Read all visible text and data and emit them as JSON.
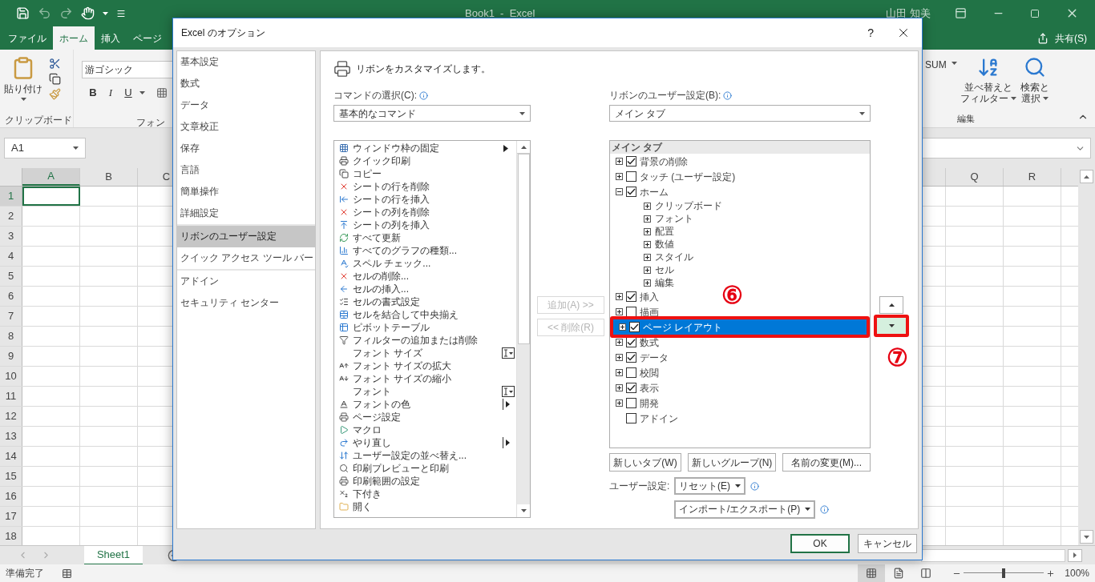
{
  "window": {
    "title": "Book1  -  Excel",
    "user": "山田 知美"
  },
  "ribbon_tabs": [
    {
      "label": "ファイル",
      "selected": false
    },
    {
      "label": "ホーム",
      "selected": true
    },
    {
      "label": "挿入",
      "selected": false
    },
    {
      "label": "ページ",
      "selected": false
    }
  ],
  "share": "共有(S)",
  "ribbon": {
    "paste": "貼り付け",
    "clipboard_group": "クリップボード",
    "font_name": "游ゴシック",
    "format_buttons": [
      "B",
      "I",
      "U"
    ],
    "font_group": "フォン",
    "autosum": "SUM",
    "sort": [
      "並べ替えと",
      "フィルター"
    ],
    "find": [
      "検索と",
      "選択"
    ],
    "editing_group": "編集"
  },
  "name_box": "A1",
  "columns": [
    "A",
    "B",
    "C",
    "Q",
    "R"
  ],
  "rows": [
    "1",
    "2",
    "3",
    "4",
    "5",
    "6",
    "7",
    "8",
    "9",
    "10",
    "11",
    "12",
    "13",
    "14",
    "15",
    "16",
    "17",
    "18"
  ],
  "sheet_tabs": [
    {
      "label": "Sheet1",
      "selected": true
    }
  ],
  "status_bar": {
    "text": "準備完了",
    "views": [
      {
        "selected": true
      },
      {
        "selected": false
      },
      {
        "selected": false
      }
    ],
    "zoom_slider": {
      "level": 0.5
    },
    "zoom": "100%"
  },
  "dialog": {
    "title": "Excel のオプション",
    "help": "?",
    "nav_sections": [
      [
        {
          "label": "基本設定",
          "selected": false
        },
        {
          "label": "数式",
          "selected": false
        },
        {
          "label": "データ",
          "selected": false
        },
        {
          "label": "文章校正",
          "selected": false
        },
        {
          "label": "保存",
          "selected": false
        },
        {
          "label": "言語",
          "selected": false
        },
        {
          "label": "簡単操作",
          "selected": false
        },
        {
          "label": "詳細設定",
          "selected": false
        }
      ],
      [
        {
          "label": "リボンのユーザー設定",
          "selected": true
        },
        {
          "label": "クイック アクセス ツール バー",
          "selected": false
        }
      ],
      [
        {
          "label": "アドイン",
          "selected": false
        },
        {
          "label": "セキュリティ センター",
          "selected": false
        }
      ]
    ],
    "heading": "リボンをカスタマイズします。",
    "commands_label": "コマンドの選択(C):",
    "commands_choice": "基本的なコマンド",
    "commands": [
      {
        "label": "ウィンドウ枠の固定",
        "kind": "submenu"
      },
      {
        "label": "クイック印刷",
        "kind": "plain"
      },
      {
        "label": "コピー",
        "kind": "plain"
      },
      {
        "label": "シートの行を削除",
        "kind": "plain"
      },
      {
        "label": "シートの行を挿入",
        "kind": "plain"
      },
      {
        "label": "シートの列を削除",
        "kind": "plain"
      },
      {
        "label": "シートの列を挿入",
        "kind": "plain"
      },
      {
        "label": "すべて更新",
        "kind": "plain"
      },
      {
        "label": "すべてのグラフの種類...",
        "kind": "plain"
      },
      {
        "label": "スペル チェック...",
        "kind": "plain"
      },
      {
        "label": "セルの削除...",
        "kind": "plain"
      },
      {
        "label": "セルの挿入...",
        "kind": "plain"
      },
      {
        "label": "セルの書式設定",
        "kind": "plain"
      },
      {
        "label": "セルを結合して中央揃え",
        "kind": "plain"
      },
      {
        "label": "ピボットテーブル",
        "kind": "plain"
      },
      {
        "label": "フィルターの追加または削除",
        "kind": "plain"
      },
      {
        "label": "フォント サイズ",
        "kind": "combo"
      },
      {
        "label": "フォント サイズの拡大",
        "kind": "plain"
      },
      {
        "label": "フォント サイズの縮小",
        "kind": "plain"
      },
      {
        "label": "フォント",
        "kind": "combo"
      },
      {
        "label": "フォントの色",
        "kind": "split"
      },
      {
        "label": "ページ設定",
        "kind": "plain"
      },
      {
        "label": "マクロ",
        "kind": "plain"
      },
      {
        "label": "やり直し",
        "kind": "split"
      },
      {
        "label": "ユーザー設定の並べ替え...",
        "kind": "plain"
      },
      {
        "label": "印刷プレビューと印刷",
        "kind": "plain"
      },
      {
        "label": "印刷範囲の設定",
        "kind": "plain"
      },
      {
        "label": "下付き",
        "kind": "plain"
      },
      {
        "label": "開く",
        "kind": "plain"
      }
    ],
    "add_button": {
      "label": "追加(A) >>",
      "disabled": true
    },
    "remove_button": {
      "label": "<< 削除(R)",
      "disabled": true
    },
    "ribbon_label": "リボンのユーザー設定(B):",
    "ribbon_choice": "メイン タブ",
    "tree_header": "メイン タブ",
    "tree": [
      {
        "label": "背景の削除",
        "checked": true,
        "expanded": false,
        "selected": false
      },
      {
        "label": "タッチ (ユーザー設定)",
        "checked": false,
        "expanded": false,
        "selected": false
      },
      {
        "label": "ホーム",
        "checked": true,
        "expanded": true,
        "selected": false,
        "children": [
          {
            "label": "クリップボード",
            "expanded": false,
            "selected": false
          },
          {
            "label": "フォント",
            "expanded": false,
            "selected": false
          },
          {
            "label": "配置",
            "expanded": false,
            "selected": false
          },
          {
            "label": "数値",
            "expanded": false,
            "selected": false
          },
          {
            "label": "スタイル",
            "expanded": false,
            "selected": false
          },
          {
            "label": "セル",
            "expanded": false,
            "selected": false
          },
          {
            "label": "編集",
            "expanded": false,
            "selected": false
          }
        ]
      },
      {
        "label": "挿入",
        "checked": true,
        "expanded": false,
        "selected": false
      },
      {
        "label": "描画",
        "checked": false,
        "expanded": false,
        "selected": false
      },
      {
        "label": "ページ レイアウト",
        "checked": true,
        "expanded": false,
        "selected": true
      },
      {
        "label": "数式",
        "checked": true,
        "expanded": false,
        "selected": false
      },
      {
        "label": "データ",
        "checked": true,
        "expanded": false,
        "selected": false
      },
      {
        "label": "校閲",
        "checked": false,
        "expanded": false,
        "selected": false
      },
      {
        "label": "表示",
        "checked": true,
        "expanded": false,
        "selected": false
      },
      {
        "label": "開発",
        "checked": false,
        "expanded": false,
        "selected": false
      },
      {
        "label": "アドイン",
        "checked": false,
        "selected": false
      }
    ],
    "move_up": {
      "highlighted": false
    },
    "move_down": {
      "highlighted": true
    },
    "tree_buttons": [
      "新しいタブ(W)",
      "新しいグループ(N)",
      "名前の変更(M)..."
    ],
    "customizations_label": "ユーザー設定:",
    "reset": "リセット(E)",
    "import_export": "インポート/エクスポート(P)",
    "ok": "OK",
    "cancel": "キャンセル",
    "annotations": [
      "⑥",
      "⑦"
    ]
  }
}
